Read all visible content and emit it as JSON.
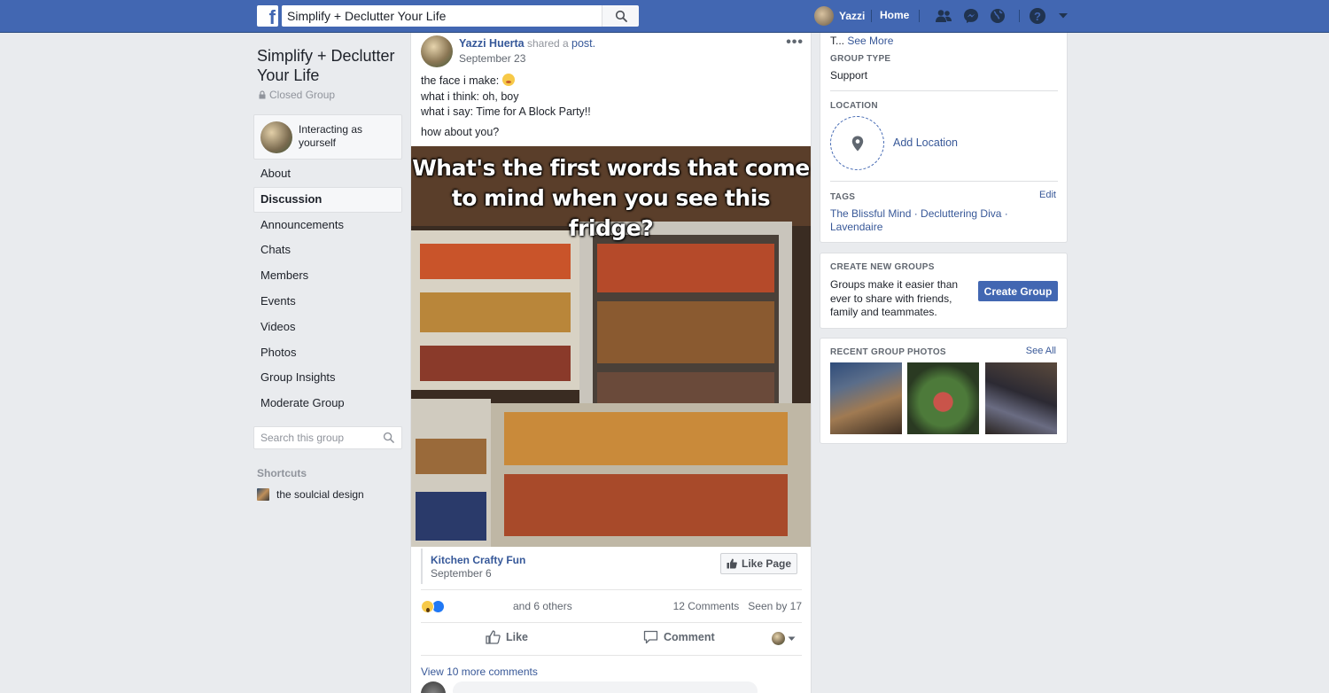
{
  "topbar": {
    "search_value": "Simplify + Declutter Your Life",
    "user_name": "Yazzi",
    "home_label": "Home"
  },
  "group": {
    "title": "Simplify + Declutter Your Life",
    "privacy": "Closed Group",
    "interacting_as": "Interacting as yourself"
  },
  "nav": {
    "items": [
      {
        "label": "About"
      },
      {
        "label": "Discussion"
      },
      {
        "label": "Announcements"
      },
      {
        "label": "Chats"
      },
      {
        "label": "Members"
      },
      {
        "label": "Events"
      },
      {
        "label": "Videos"
      },
      {
        "label": "Photos"
      },
      {
        "label": "Group Insights"
      },
      {
        "label": "Moderate Group"
      }
    ],
    "active": "Discussion",
    "search_placeholder": "Search this group"
  },
  "shortcuts": {
    "heading": "Shortcuts",
    "items": [
      {
        "label": "the soulcial design"
      }
    ]
  },
  "post": {
    "author": "Yazzi Huerta",
    "action": "shared a",
    "object": "post.",
    "date": "September 23",
    "lines": [
      "the face i make: ",
      "what i think: oh, boy",
      "what i say: Time for A Block Party!!",
      "how about you?"
    ],
    "image_caption": "What's the first words that come to mind when you see this fridge?",
    "shared_page": {
      "name": "Kitchen Crafty Fun",
      "date": "September 6",
      "like_label": "Like Page"
    },
    "reactions": {
      "others": "and 6 others",
      "comments": "12 Comments",
      "seen": "Seen by 17"
    },
    "actions": {
      "like": "Like",
      "comment": "Comment"
    },
    "view_more": "View 10 more comments"
  },
  "sidebar_right": {
    "about_truncated": "T...",
    "see_more": "See More",
    "group_type_label": "GROUP TYPE",
    "group_type": "Support",
    "location_label": "LOCATION",
    "add_location": "Add Location",
    "tags_label": "TAGS",
    "tags_edit": "Edit",
    "tags": [
      "The Blissful Mind",
      "Decluttering Diva",
      "Lavendaire"
    ],
    "create": {
      "label": "CREATE NEW GROUPS",
      "desc": "Groups make it easier than ever to share with friends, family and teammates.",
      "button": "Create Group"
    },
    "photos": {
      "label": "RECENT GROUP PHOTOS",
      "see_all": "See All"
    }
  },
  "colors": {
    "brand": "#4267b2",
    "link": "#385898",
    "background": "#e9ebee"
  }
}
